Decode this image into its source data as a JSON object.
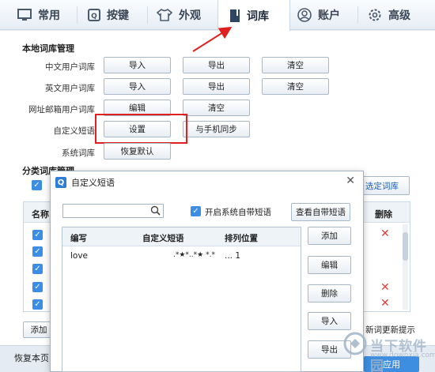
{
  "tabs": [
    {
      "label": "常用",
      "icon": "monitor-icon"
    },
    {
      "label": "按键",
      "icon": "key-icon"
    },
    {
      "label": "外观",
      "icon": "shirt-icon"
    },
    {
      "label": "词库",
      "icon": "book-icon"
    },
    {
      "label": "账户",
      "icon": "user-icon"
    },
    {
      "label": "高级",
      "icon": "gear-icon"
    }
  ],
  "local": {
    "section_title": "本地词库管理",
    "rows": [
      {
        "label": "中文用户词库",
        "buttons": [
          "导入",
          "导出",
          "清空"
        ]
      },
      {
        "label": "英文用户词库",
        "buttons": [
          "导入",
          "导出",
          "清空"
        ]
      },
      {
        "label": "网址邮箱用户词库",
        "buttons": [
          "编辑",
          "清空"
        ]
      },
      {
        "label": "自定义短语",
        "buttons": [
          "设置",
          "与手机同步"
        ]
      },
      {
        "label": "系统词库",
        "buttons": [
          "恢复默认"
        ]
      }
    ]
  },
  "category": {
    "section_title": "分类词库管理",
    "select_button": "选定词库",
    "col_name": "名称",
    "col_delete": "删除",
    "add_button": "添加",
    "update_notice": "新词更新提示",
    "restore_button": "恢复本页",
    "apply_button": "应用"
  },
  "dialog": {
    "title": "自定义短语",
    "checkbox_label": "开启系统自带短语",
    "view_button": "查看自带短语",
    "columns": [
      "编写",
      "自定义短语",
      "排列位置"
    ],
    "rows": [
      {
        "code": "love",
        "phrase": ".*★*..*★ *.*",
        "position": "... 1"
      }
    ],
    "buttons": [
      "添加",
      "编辑",
      "删除",
      "导入",
      "导出"
    ]
  },
  "watermark": {
    "text": "当下软件园",
    "url": "www.downxia.com"
  },
  "colors": {
    "accent_red": "#e02020",
    "checkbox_blue": "#3b8ee3"
  }
}
